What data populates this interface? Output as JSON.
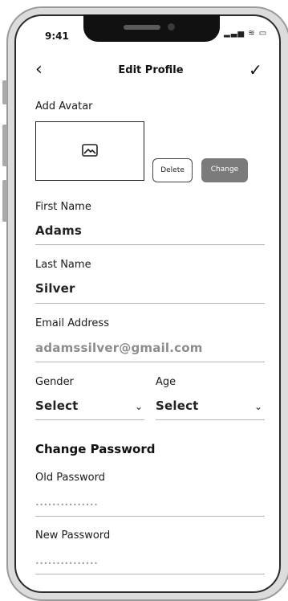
{
  "status_bar": {
    "time": "9:41",
    "icons": "▂▃▅ ≋ ▭"
  },
  "header": {
    "title": "Edit Profile",
    "back_icon": "chevron-left-icon",
    "confirm_icon": "checkmark-icon"
  },
  "avatar": {
    "label": "Add Avatar",
    "icon": "image-icon",
    "delete_label": "Delete",
    "change_label": "Change"
  },
  "form": {
    "first_name": {
      "label": "First Name",
      "value": "Adams"
    },
    "last_name": {
      "label": "Last Name",
      "value": "Silver"
    },
    "email": {
      "label": "Email Address",
      "placeholder": "adamssilver@gmail.com"
    },
    "gender": {
      "label": "Gender",
      "selected": "Select"
    },
    "age": {
      "label": "Age",
      "selected": "Select"
    }
  },
  "password": {
    "section_title": "Change Password",
    "old": {
      "label": "Old Password",
      "masked": "•••••••••••••••"
    },
    "new": {
      "label": "New Password",
      "masked": "•••••••••••••••"
    }
  },
  "colors": {
    "change_button_bg": "#7b7b7b",
    "underline": "#b5b5b5",
    "placeholder": "#8c8c8c"
  }
}
